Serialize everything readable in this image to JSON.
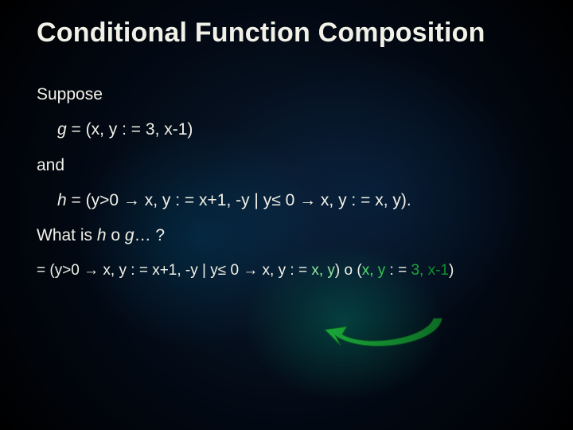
{
  "title": "Conditional Function Composition",
  "lines": {
    "suppose": "Suppose",
    "g_def_prefix": "g",
    "g_def_rest": " = (x, y : = 3, x-1)",
    "and": "and",
    "h_def_prefix": "h",
    "h_def_rest": " = (y>0 → x, y : = x+1, -y | y≤ 0 → x, y : = x, y).",
    "what_prefix": "What is ",
    "what_h": "h",
    "what_mid": " o ",
    "what_g": "g",
    "what_end": "… ?",
    "final_eq": "= (y>0 → x, y : = x+1, -y | y≤ 0 → x, y : = ",
    "final_xy": "x, y",
    "final_paren_o": ") o (",
    "final_xy2": "x, ",
    "final_y": "y",
    "final_assign": " : = ",
    "final_3": "3, ",
    "final_xm1": "x-1",
    "final_close": ")"
  }
}
